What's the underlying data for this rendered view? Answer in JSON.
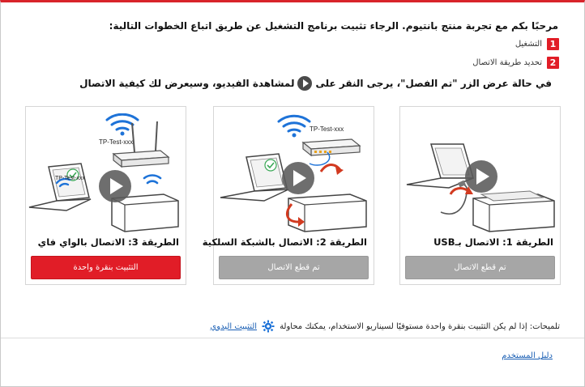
{
  "intro": "مرحبًا بكم مع تجربة منتج بانتيوم. الرجاء تثبيت برنامج التشغيل عن طريق اتباع الخطوات التالية:",
  "steps": [
    {
      "num": "1",
      "label": "التشغيل"
    },
    {
      "num": "2",
      "label": "تحديد طريقة الاتصال"
    }
  ],
  "hint": {
    "before": "في حالة عرض الزر \"تم الفصل\"، يرجى النقر على",
    "after": "لمشاهدة الفيديو، وسيعرض لك كيفية الاتصال"
  },
  "cards": [
    {
      "title": "الطريقة 1: الاتصال بـUSB",
      "button": "تم قطع الاتصال",
      "button_state": "disabled",
      "icon": "usb-connection-illustration"
    },
    {
      "title": "الطريقة 2: الاتصال بالشبكة السلكية",
      "button": "تم قطع الاتصال",
      "button_state": "disabled",
      "icon": "wired-network-illustration",
      "ssid": "TP-Test-xxx"
    },
    {
      "title": "الطريقة 3: الاتصال بالواي فاي",
      "button": "التثبيت بنقرة واحدة",
      "button_state": "active",
      "icon": "wifi-illustration",
      "ssid": "TP-Test-xxx",
      "laptop_ssid": "TP-Test-xxx"
    }
  ],
  "tips": {
    "text": "تلميحات: إذا لم يكن التثبيت بنقرة واحدة مستوفيًا لسيناريو الاستخدام، يمكنك محاولة",
    "link": "التثبيت اليدوي"
  },
  "footer": {
    "user_guide": "دليل المستخدم"
  },
  "colors": {
    "accent": "#e11d27",
    "disabled": "#a6a6a6",
    "link": "#1a5fb4",
    "wifi": "#1e73d8"
  }
}
